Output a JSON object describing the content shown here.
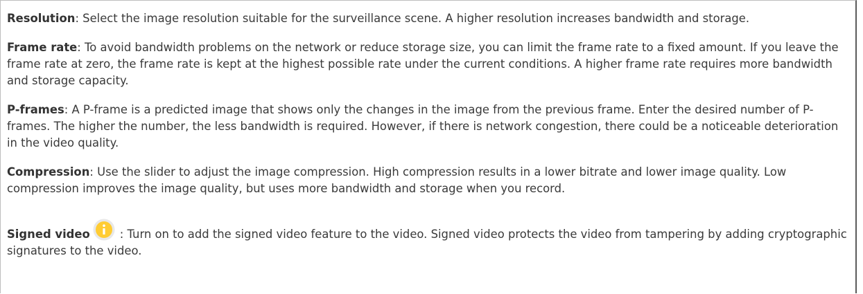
{
  "sections": {
    "resolution": {
      "term": "Resolution",
      "text": ": Select the image resolution suitable for the surveillance scene. A higher resolution increases bandwidth and storage."
    },
    "frame_rate": {
      "term": "Frame rate",
      "text": ": To avoid bandwidth problems on the network or reduce storage size, you can limit the frame rate to a fixed amount. If you leave the frame rate at zero, the frame rate is kept at the highest possible rate under the current conditions. A higher frame rate requires more bandwidth and storage capacity."
    },
    "p_frames": {
      "term": "P-frames",
      "text": ": A P-frame is a predicted image that shows only the changes in the image from the previous frame. Enter the desired number of P-frames. The higher the number, the less bandwidth is required. However, if there is network congestion, there could be a noticeable deterioration in the video quality."
    },
    "compression": {
      "term": "Compression",
      "text": ": Use the slider to adjust the image compression. High compression results in a lower bitrate and lower image quality. Low compression improves the image quality, but uses more bandwidth and storage when you record."
    },
    "signed_video": {
      "term": "Signed video",
      "text": ": Turn on to add the signed video feature to the video. Signed video protects the video from tampering by adding cryptographic signatures to the video.",
      "icon": "info-icon"
    }
  },
  "colors": {
    "text": "#3a3a3a",
    "info_icon_fill": "#ffcc33",
    "info_icon_ring": "#e8e8e8",
    "info_icon_glyph": "#ffffff"
  }
}
